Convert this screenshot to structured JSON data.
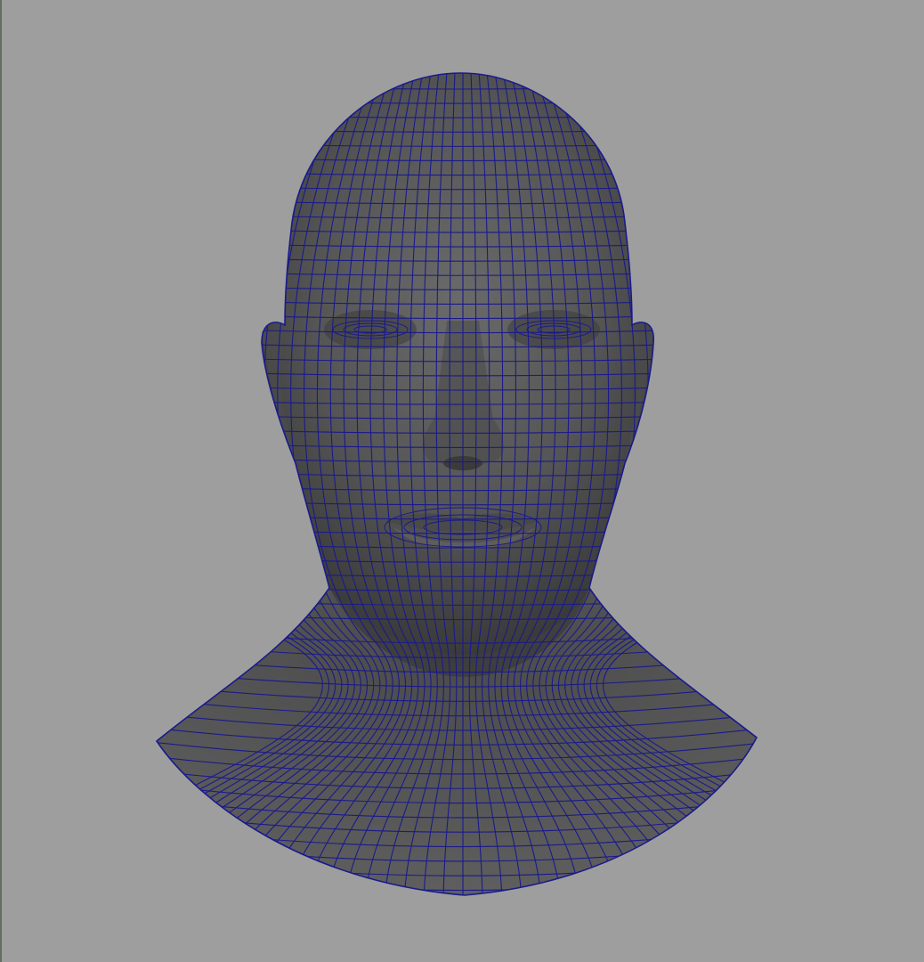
{
  "viewport": {
    "background_color": "#9e9e9e",
    "display_mode": "wireframe-on-shaded",
    "model_subject": "human-head-bust",
    "mesh": {
      "surface_color": "#5a5a5a",
      "wire_color": "#1a1a8c"
    }
  }
}
